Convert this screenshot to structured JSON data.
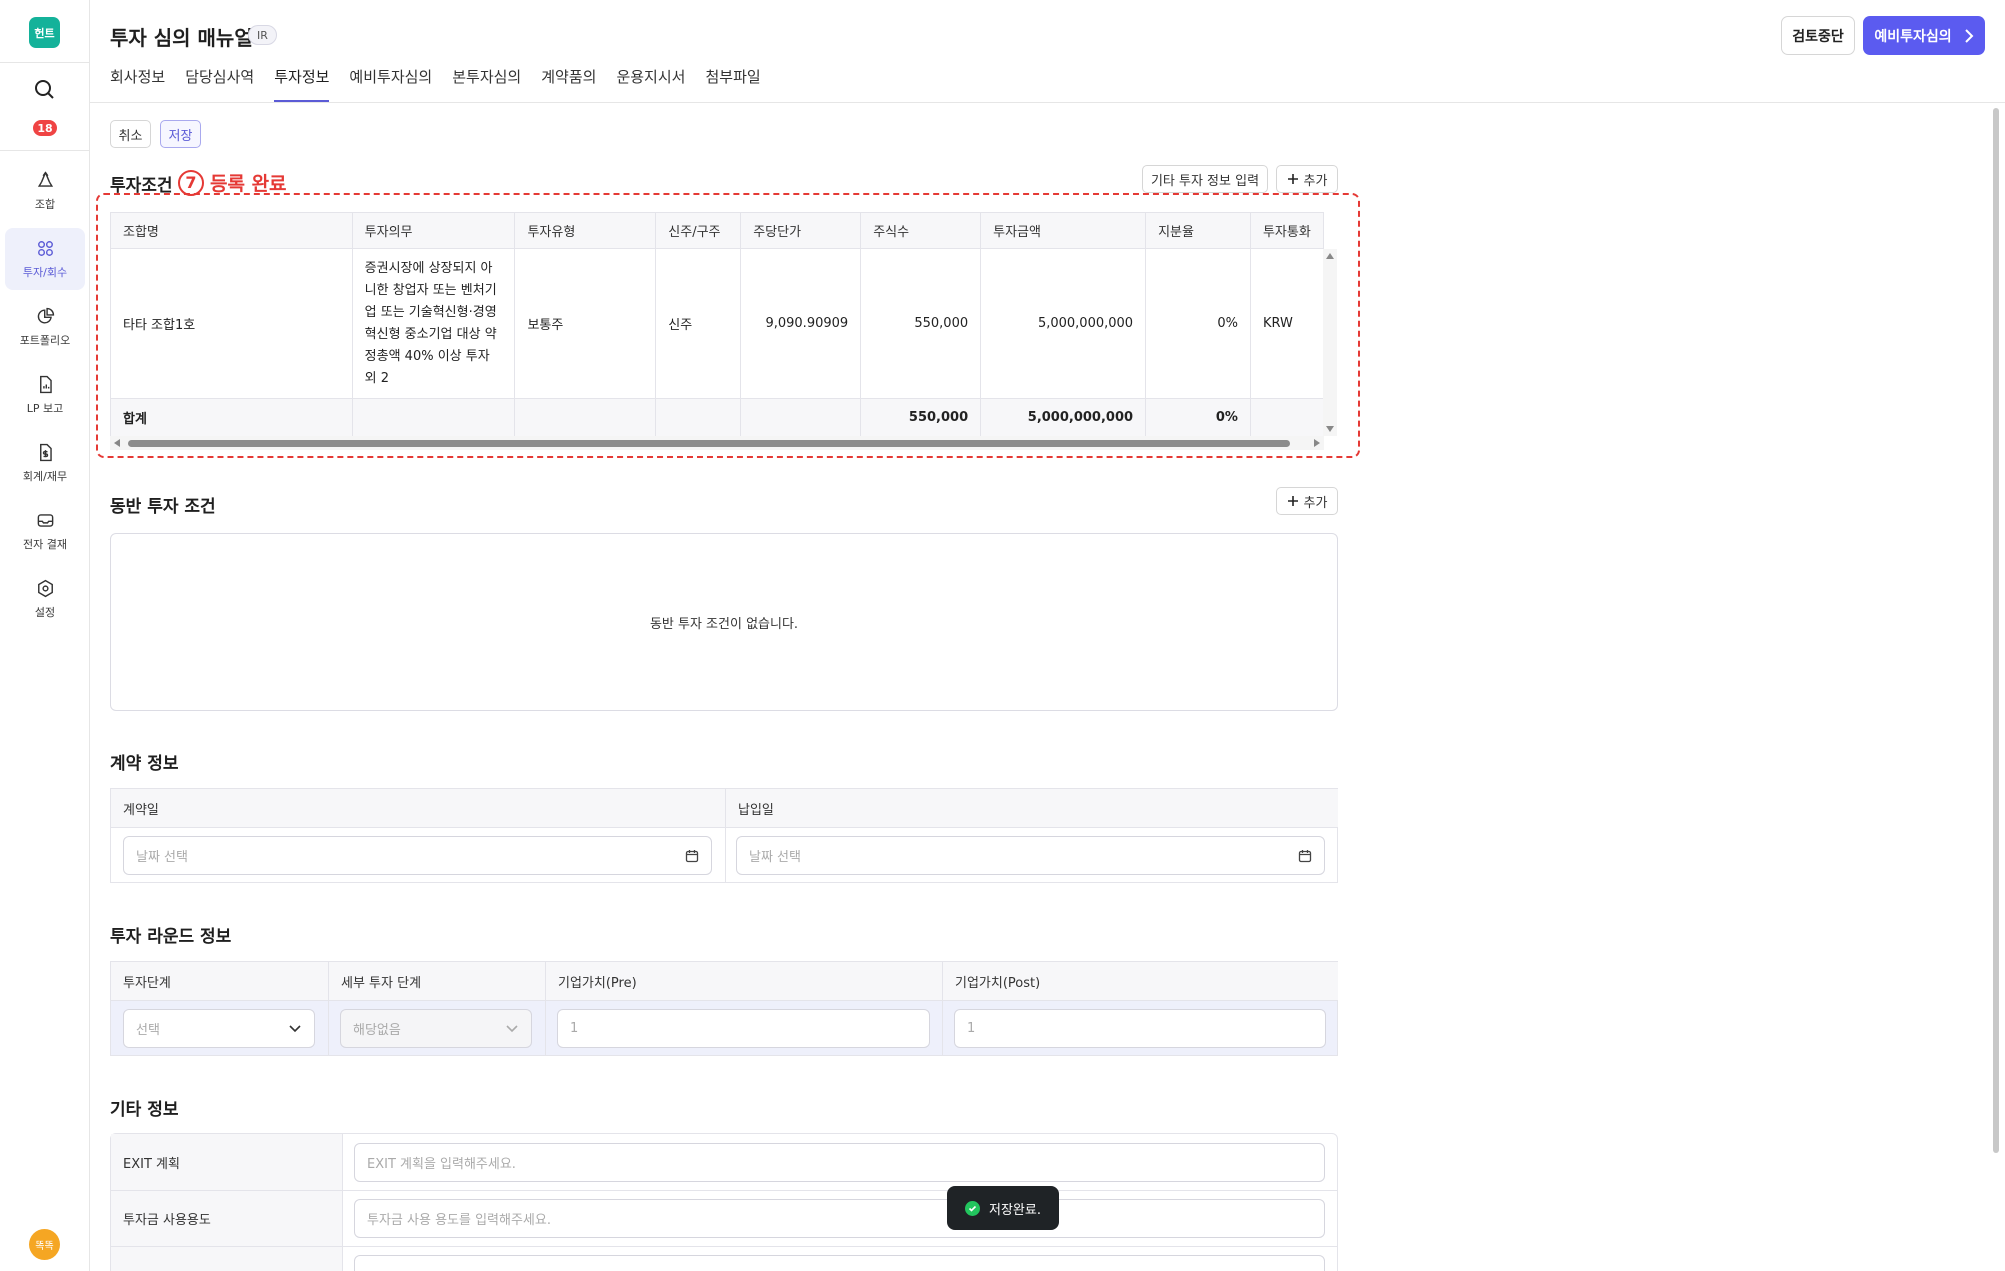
{
  "app": {
    "logo_text": "헌트",
    "notification_count": "18",
    "user_avatar": "똑똑"
  },
  "sidebar": {
    "items": [
      {
        "label": "조합",
        "icon": "recycle-icon"
      },
      {
        "label": "투자/회수",
        "icon": "investment-icon"
      },
      {
        "label": "포트폴리오",
        "icon": "pie-chart-icon"
      },
      {
        "label": "LP 보고",
        "icon": "report-icon"
      },
      {
        "label": "회계/재무",
        "icon": "accounting-icon"
      },
      {
        "label": "전자 결재",
        "icon": "inbox-icon"
      },
      {
        "label": "설정",
        "icon": "gear-icon"
      }
    ]
  },
  "header": {
    "title": "투자 심의 매뉴얼",
    "badge": "IR",
    "stop_review": "검토중단",
    "primary_action": "예비투자심의",
    "tabs": [
      "회사정보",
      "담당심사역",
      "투자정보",
      "예비투자심의",
      "본투자심의",
      "계약품의",
      "운용지시서",
      "첨부파일"
    ],
    "active_tab": "투자정보"
  },
  "toolbar": {
    "cancel": "취소",
    "save": "저장"
  },
  "investment_terms": {
    "title": "투자조건",
    "annotation_number": "7",
    "annotation_text": "등록 완료",
    "other_info_button": "기타 투자 정보 입력",
    "add_button": "추가",
    "columns": [
      "조합명",
      "투자의무",
      "투자유형",
      "신주/구주",
      "주당단가",
      "주식수",
      "투자금액",
      "지분율",
      "투자통화"
    ],
    "rows": [
      {
        "fund": "타타 조합1호",
        "duty": "증권시장에 상장되지 아니한 창업자 또는 벤처기업 또는 기술혁신형·경영혁신형 중소기업 대상 약정총액 40% 이상 투자 외 2",
        "type": "보통주",
        "issue": "신주",
        "price": "9,090.90909",
        "shares": "550,000",
        "amount": "5,000,000,000",
        "ratio": "0%",
        "currency": "KRW"
      }
    ],
    "total": {
      "label": "합계",
      "shares": "550,000",
      "amount": "5,000,000,000",
      "ratio": "0%"
    }
  },
  "co_investment": {
    "title": "동반 투자 조건",
    "add_button": "추가",
    "empty_message": "동반 투자 조건이 없습니다."
  },
  "contract_info": {
    "title": "계약 정보",
    "contract_date_label": "계약일",
    "payment_date_label": "납입일",
    "date_placeholder": "날짜 선택"
  },
  "round_info": {
    "title": "투자 라운드 정보",
    "stage_label": "투자단계",
    "sub_stage_label": "세부 투자 단계",
    "pre_label": "기업가치(Pre)",
    "post_label": "기업가치(Post)",
    "stage_value": "선택",
    "sub_stage_value": "해당없음",
    "pre_value": "1",
    "post_value": "1"
  },
  "other_info": {
    "title": "기타 정보",
    "exit_label": "EXIT 계획",
    "exit_placeholder": "EXIT 계획을 입력해주세요.",
    "usage_label": "투자금 사용용도",
    "usage_placeholder": "투자금 사용 용도를 입력해주세요."
  },
  "toast": {
    "message": "저장완료."
  },
  "colors": {
    "brand": "#14b29a",
    "primary": "#5b5bf0",
    "annotation": "#e53935",
    "badge": "#ef4444"
  }
}
